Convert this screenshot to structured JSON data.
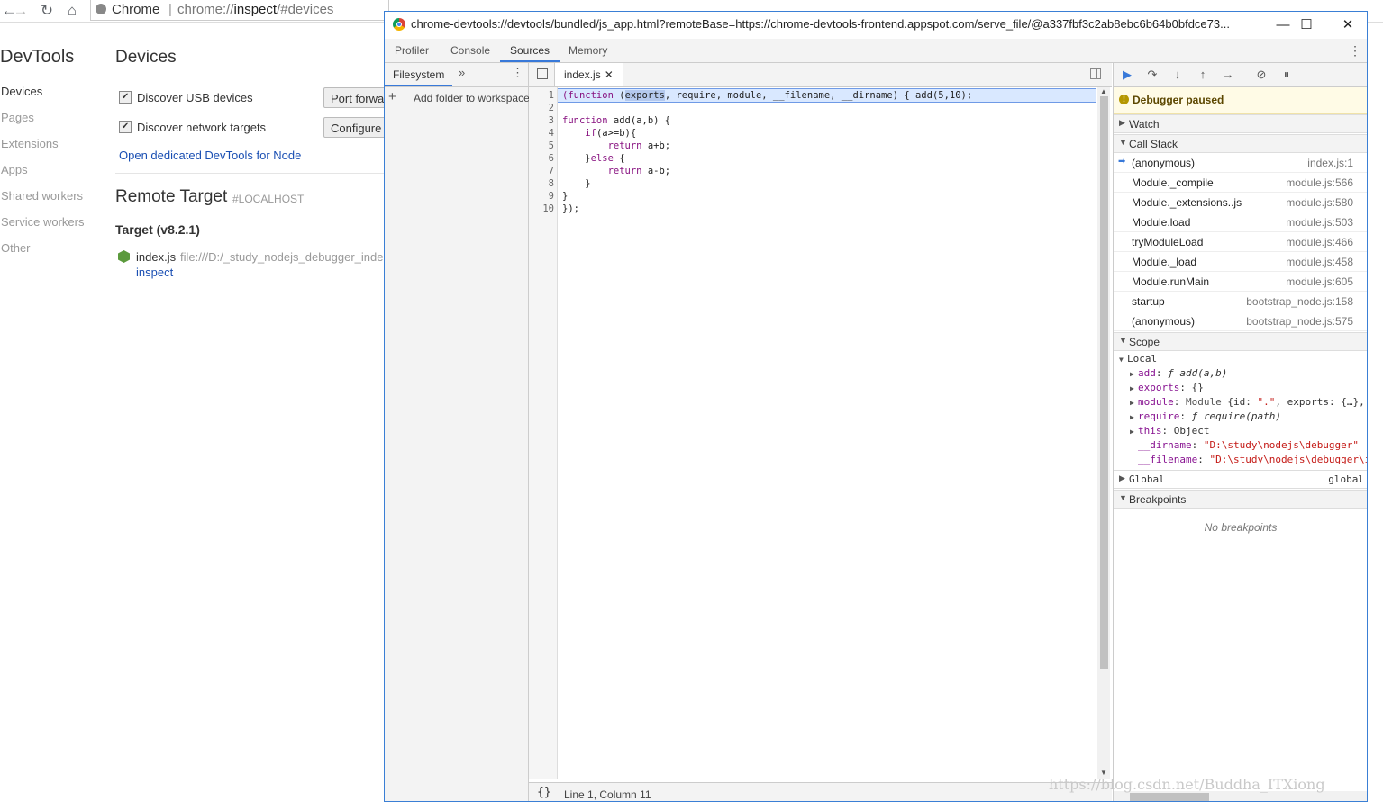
{
  "browser": {
    "omnibox_brand": "Chrome",
    "omnibox_sep": "|",
    "omnibox_scheme": "chrome://",
    "omnibox_host": "inspect",
    "omnibox_path": "/#devices"
  },
  "inspect_page": {
    "logo": "DevTools",
    "nav": [
      "Devices",
      "Pages",
      "Extensions",
      "Apps",
      "Shared workers",
      "Service workers",
      "Other"
    ],
    "devices_title": "Devices",
    "discover_usb": "Discover USB devices",
    "port_forwarding_btn": "Port forwa",
    "discover_network": "Discover network targets",
    "configure_btn": "Configure",
    "open_node_link": "Open dedicated DevTools for Node",
    "remote_target": "Remote Target",
    "localhost": "#LOCALHOST",
    "target_version": "Target (v8.2.1)",
    "target_file": "index.js",
    "target_path": "file:///D:/_study_nodejs_debugger_inde",
    "inspect_link": "inspect"
  },
  "devtools": {
    "window_title": "chrome-devtools://devtools/bundled/js_app.html?remoteBase=https://chrome-devtools-frontend.appspot.com/serve_file/@a337fbf3c2ab8ebc6b64b0bfdce73...",
    "tabs": [
      "Profiler",
      "Console",
      "Sources",
      "Memory"
    ],
    "active_tab": "Sources",
    "navigator": {
      "tab": "Filesystem",
      "more": "»",
      "add_folder": "Add folder to workspace"
    },
    "editor": {
      "file_tab": "index.js",
      "line_numbers": [
        "1",
        "2",
        "3",
        "4",
        "5",
        "6",
        "7",
        "8",
        "9",
        "10"
      ],
      "status": "Line 1, Column 11",
      "pretty_print": "{}"
    },
    "debugger": {
      "paused": "Debugger paused",
      "watch": "Watch",
      "call_stack_title": "Call Stack",
      "call_stack": [
        {
          "name": "(anonymous)",
          "loc": "index.js:1"
        },
        {
          "name": "Module._compile",
          "loc": "module.js:566"
        },
        {
          "name": "Module._extensions..js",
          "loc": "module.js:580"
        },
        {
          "name": "Module.load",
          "loc": "module.js:503"
        },
        {
          "name": "tryModuleLoad",
          "loc": "module.js:466"
        },
        {
          "name": "Module._load",
          "loc": "module.js:458"
        },
        {
          "name": "Module.runMain",
          "loc": "module.js:605"
        },
        {
          "name": "startup",
          "loc": "bootstrap_node.js:158"
        },
        {
          "name": "(anonymous)",
          "loc": "bootstrap_node.js:575"
        }
      ],
      "scope_title": "Scope",
      "local_title": "Local",
      "global_title": "Global",
      "global_value": "global",
      "breakpoints_title": "Breakpoints",
      "no_breakpoints": "No breakpoints"
    }
  },
  "watermark": "https://blog.csdn.net/Buddha_ITXiong"
}
